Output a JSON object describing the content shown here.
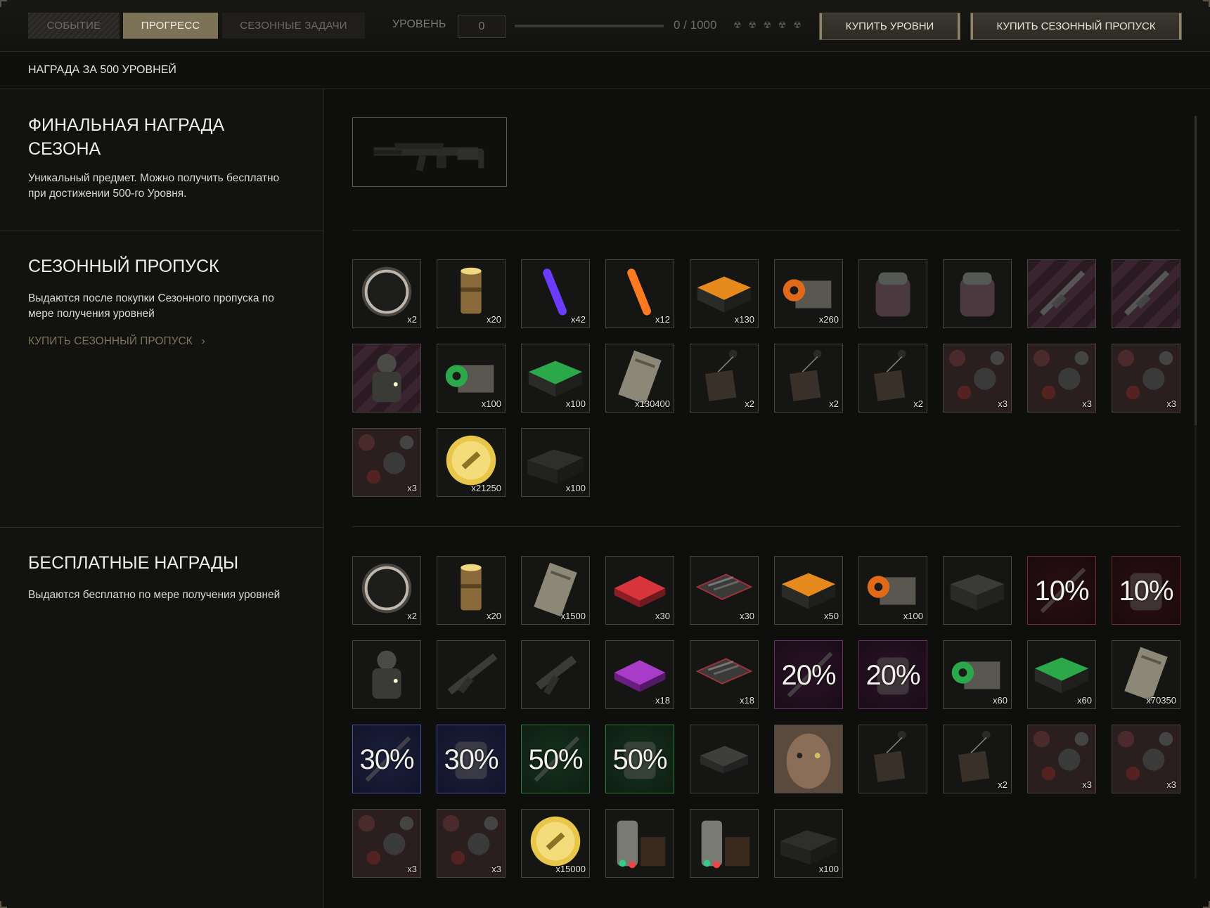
{
  "tabs": [
    {
      "label": "Событие"
    },
    {
      "label": "Прогресс"
    },
    {
      "label": "Сезонные задачи"
    }
  ],
  "level": {
    "label": "Уровень",
    "value": "0",
    "xp_text": "0 / 1000",
    "progress": 0
  },
  "buttons": {
    "buy_levels": "Купить уровни",
    "buy_pass": "Купить сезонный пропуск"
  },
  "subheader": "Награда за 500 уровней",
  "sections": {
    "final": {
      "title": "Финальная награда сезона",
      "desc": "Уникальный предмет. Можно получить бесплатно при достижении 500-го Уровня."
    },
    "pass": {
      "title": "Сезонный пропуск",
      "desc": "Выдаются после покупки Сезонного пропуска по мере получения уровней",
      "link": "Купить сезонный пропуск"
    },
    "free": {
      "title": "Бесплатные награды",
      "desc": "Выдаются бесплатно по мере получения уровней"
    }
  },
  "pass_rewards": [
    {
      "icon": "token-coin-icon",
      "count": "x2"
    },
    {
      "icon": "canister-icon",
      "count": "x20"
    },
    {
      "icon": "purple-glowstick-icon",
      "count": "x42"
    },
    {
      "icon": "orange-glowstick-icon",
      "count": "x12"
    },
    {
      "icon": "orange-case-icon",
      "count": "x130"
    },
    {
      "icon": "orange-box-icon",
      "count": "x260"
    },
    {
      "icon": "backpack-icon",
      "count": ""
    },
    {
      "icon": "backpack-icon",
      "count": ""
    },
    {
      "icon": "rifle-skin-icon",
      "count": ""
    },
    {
      "icon": "rifle-skin-icon",
      "count": ""
    },
    {
      "icon": "armor-character-icon",
      "count": ""
    },
    {
      "icon": "green-box-icon",
      "count": "x100"
    },
    {
      "icon": "green-case-icon",
      "count": "x100"
    },
    {
      "icon": "document-crate-icon",
      "count": "x130400"
    },
    {
      "icon": "pendant-icon",
      "count": "x2"
    },
    {
      "icon": "pendant-icon",
      "count": "x2"
    },
    {
      "icon": "pendant-icon",
      "count": "x2"
    },
    {
      "icon": "camo-pattern-icon",
      "count": "x3"
    },
    {
      "icon": "camo-pattern-icon",
      "count": "x3"
    },
    {
      "icon": "camo-pattern-icon",
      "count": "x3"
    },
    {
      "icon": "camo-pattern-icon",
      "count": "x3"
    },
    {
      "icon": "gold-chain-coin-icon",
      "count": "x21250"
    },
    {
      "icon": "ammo-crate-icon",
      "count": "x100"
    }
  ],
  "free_rewards": [
    {
      "icon": "token-coin-icon",
      "count": "x2"
    },
    {
      "icon": "canister-icon",
      "count": "x20"
    },
    {
      "icon": "document-icon",
      "count": "x1500"
    },
    {
      "icon": "red-case-icon",
      "count": "x30"
    },
    {
      "icon": "weapon-case-icon",
      "count": "x30"
    },
    {
      "icon": "orange-case-icon",
      "count": "x50"
    },
    {
      "icon": "orange-box-icon",
      "count": "x100"
    },
    {
      "icon": "crate-icon",
      "count": ""
    },
    {
      "icon": "discount-weapon-icon",
      "count": "",
      "pct": "10%"
    },
    {
      "icon": "discount-armor-icon",
      "count": "",
      "pct": "10%"
    },
    {
      "icon": "armor-character-icon",
      "count": ""
    },
    {
      "icon": "rifle-icon",
      "count": ""
    },
    {
      "icon": "smg-icon",
      "count": ""
    },
    {
      "icon": "purple-case-icon",
      "count": "x18"
    },
    {
      "icon": "weapon-case-icon",
      "count": "x18"
    },
    {
      "icon": "discount-weapon-icon",
      "count": "",
      "pct": "20%"
    },
    {
      "icon": "discount-armor-icon",
      "count": "",
      "pct": "20%"
    },
    {
      "icon": "green-box-icon",
      "count": "x60"
    },
    {
      "icon": "green-case-icon",
      "count": "x60"
    },
    {
      "icon": "document-crate-icon",
      "count": "x70350"
    },
    {
      "icon": "discount-weapon-icon",
      "count": "",
      "pct": "30%"
    },
    {
      "icon": "discount-armor-icon",
      "count": "",
      "pct": "30%"
    },
    {
      "icon": "discount-weapon-icon",
      "count": "",
      "pct": "50%"
    },
    {
      "icon": "discount-armor-icon",
      "count": "",
      "pct": "50%"
    },
    {
      "icon": "small-case-icon",
      "count": ""
    },
    {
      "icon": "face-portrait-icon",
      "count": ""
    },
    {
      "icon": "pendant-icon",
      "count": ""
    },
    {
      "icon": "pendant-icon",
      "count": "x2"
    },
    {
      "icon": "camo-pattern-icon",
      "count": "x3"
    },
    {
      "icon": "camo-pattern-icon",
      "count": "x3"
    },
    {
      "icon": "camo-pattern-icon",
      "count": "x3"
    },
    {
      "icon": "camo-pattern-icon",
      "count": "x3"
    },
    {
      "icon": "gold-chain-coin-icon",
      "count": "x15000"
    },
    {
      "icon": "lab-equipment-icon",
      "count": ""
    },
    {
      "icon": "lab-equipment-icon",
      "count": ""
    },
    {
      "icon": "ammo-crate-icon",
      "count": "x100"
    }
  ],
  "final_reward": {
    "icon": "assault-rifle-icon"
  },
  "colors": {
    "accent": "#7c7257",
    "link": "#7d7459",
    "discount_red": "#7a2a2a",
    "discount_purple": "#6d2b63",
    "discount_blue": "#4a4f9a",
    "discount_green": "#2f7a3c"
  }
}
